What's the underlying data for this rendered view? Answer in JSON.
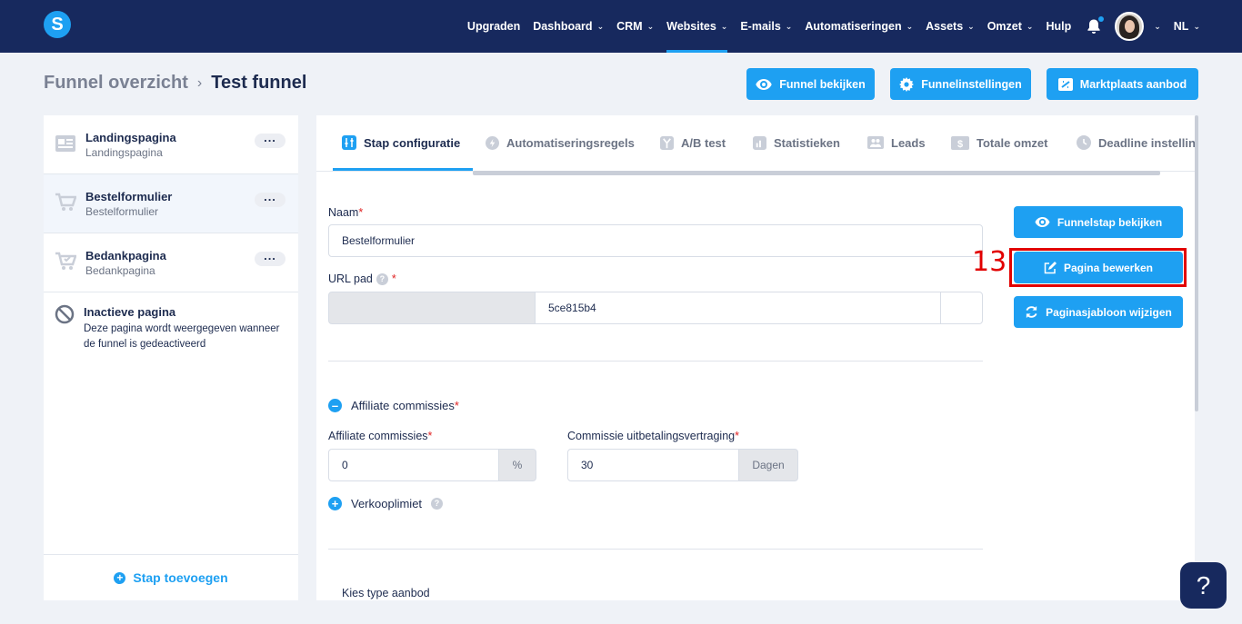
{
  "nav": {
    "logo": "S",
    "items": [
      {
        "label": "Upgraden",
        "dropdown": false,
        "active": false
      },
      {
        "label": "Dashboard",
        "dropdown": true,
        "active": false
      },
      {
        "label": "CRM",
        "dropdown": true,
        "active": false
      },
      {
        "label": "Websites",
        "dropdown": true,
        "active": true
      },
      {
        "label": "E-mails",
        "dropdown": true,
        "active": false
      },
      {
        "label": "Automatiseringen",
        "dropdown": true,
        "active": false
      },
      {
        "label": "Assets",
        "dropdown": true,
        "active": false
      },
      {
        "label": "Omzet",
        "dropdown": true,
        "active": false
      },
      {
        "label": "Hulp",
        "dropdown": false,
        "active": false
      }
    ],
    "language": "NL"
  },
  "breadcrumb": {
    "parent": "Funnel overzicht",
    "current": "Test funnel"
  },
  "top_buttons": {
    "view_funnel": "Funnel bekijken",
    "funnel_settings": "Funnelinstellingen",
    "marketplace": "Marktplaats aanbod"
  },
  "steps": [
    {
      "title": "Landingspagina",
      "subtitle": "Landingspagina",
      "icon": "page-icon"
    },
    {
      "title": "Bestelformulier",
      "subtitle": "Bestelformulier",
      "icon": "cart-icon"
    },
    {
      "title": "Bedankpagina",
      "subtitle": "Bedankpagina",
      "icon": "cart-check-icon"
    }
  ],
  "inactive": {
    "title": "Inactieve pagina",
    "description": "Deze pagina wordt weergegeven wanneer de funnel is gedeactiveerd"
  },
  "add_step": "Stap toevoegen",
  "tabs": [
    {
      "label": "Stap configuratie",
      "active": true
    },
    {
      "label": "Automatiseringsregels",
      "active": false
    },
    {
      "label": "A/B test",
      "active": false
    },
    {
      "label": "Statistieken",
      "active": false
    },
    {
      "label": "Leads",
      "active": false
    },
    {
      "label": "Totale omzet",
      "active": false
    },
    {
      "label": "Deadline instellin",
      "active": false
    }
  ],
  "form": {
    "name_label": "Naam",
    "name_value": "Bestelformulier",
    "url_label": "URL pad",
    "url_value": "5ce815b4",
    "affiliate_toggle": "Affiliate commissies",
    "affiliate_label": "Affiliate commissies",
    "affiliate_value": "0",
    "affiliate_unit": "%",
    "payout_label": "Commissie uitbetalingsvertraging",
    "payout_value": "30",
    "payout_unit": "Dagen",
    "limit_toggle": "Verkooplimiet",
    "offer_type_label": "Kies type aanbod",
    "required_mark": "*",
    "help_mark": "?"
  },
  "side_buttons": {
    "view_step": "Funnelstap bekijken",
    "edit_page": "Pagina bewerken",
    "change_template": "Paginasjabloon wijzigen"
  },
  "annotation": "13",
  "help_button": "?",
  "colors": {
    "nav_bg": "#17295e",
    "accent": "#1ea0f2",
    "highlight": "#e20000"
  }
}
